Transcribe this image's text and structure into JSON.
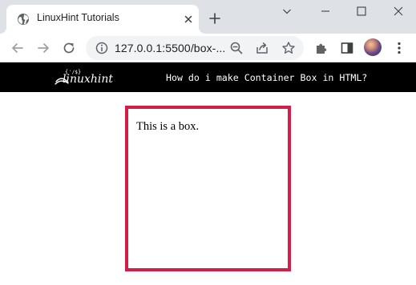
{
  "browser": {
    "tab": {
      "title": "LinuxHint Tutorials",
      "favicon": "globe-icon"
    },
    "address_bar": {
      "url": "127.0.0.1:5500/box-..."
    },
    "toolbar_icons": [
      "back-arrow-icon",
      "forward-arrow-icon",
      "reload-icon",
      "info-icon",
      "zoom-icon",
      "share-icon",
      "bookmark-star-icon",
      "extensions-puzzle-icon",
      "side-panel-icon",
      "avatar",
      "more-menu-icon"
    ],
    "window_controls": [
      "minimize-icon",
      "maximize-icon",
      "close-icon"
    ]
  },
  "site_header": {
    "logo_text": "linuxhint",
    "title": "How do i make Container Box in HTML?"
  },
  "content": {
    "box_text": "This is a box.",
    "box_border_color": "#d21f47"
  }
}
